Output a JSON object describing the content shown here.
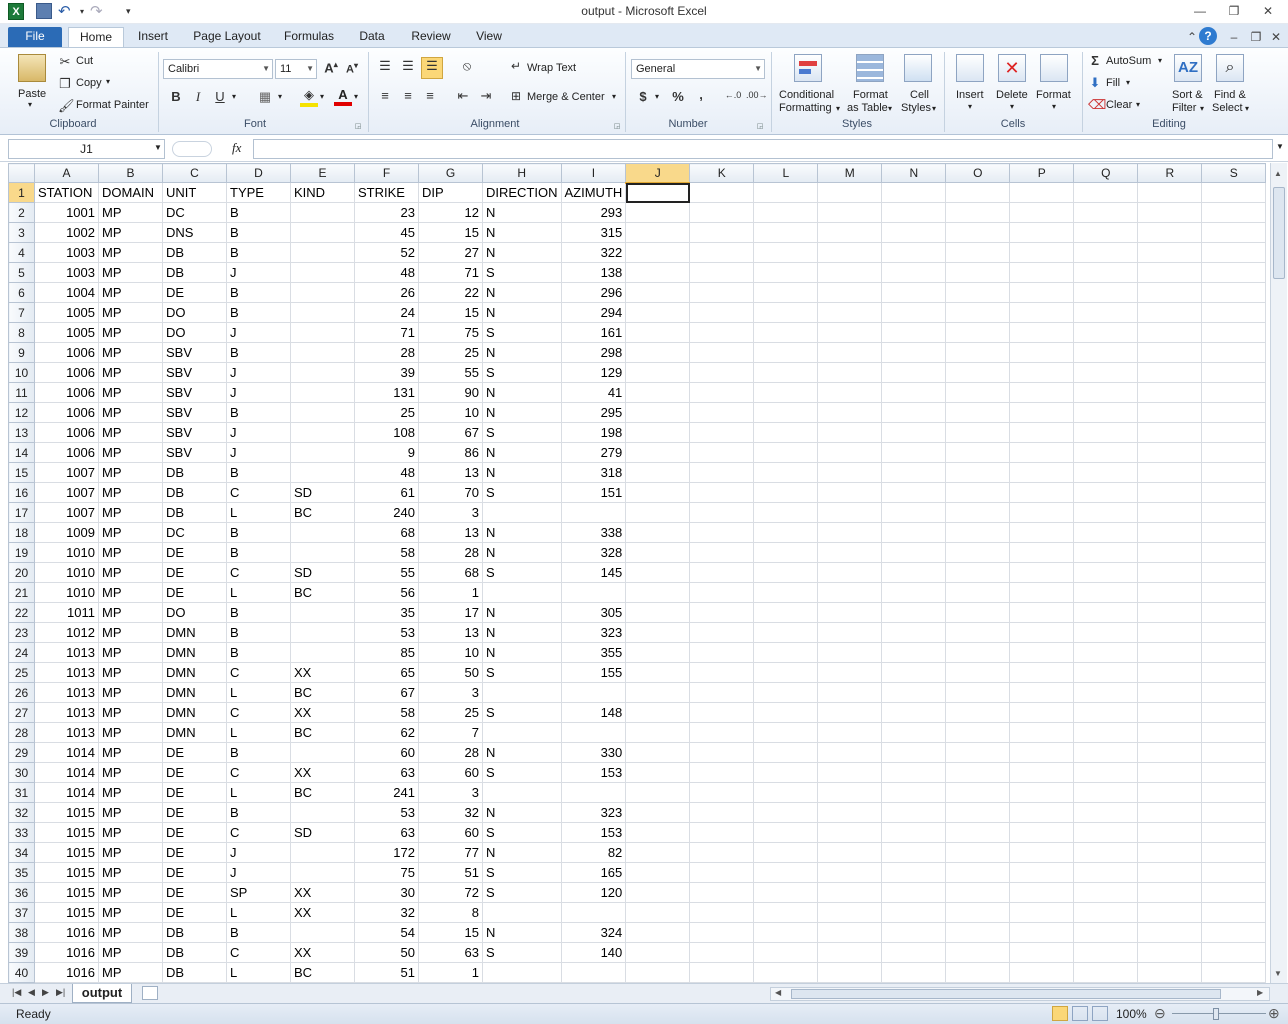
{
  "app": {
    "title": "output  -  Microsoft Excel",
    "logo": "X"
  },
  "qat": {
    "save_icon": "save-icon",
    "undo_icon": "undo-icon",
    "redo_icon": "redo-icon"
  },
  "tabs": {
    "file": "File",
    "home": "Home",
    "insert": "Insert",
    "page_layout": "Page Layout",
    "formulas": "Formulas",
    "data": "Data",
    "review": "Review",
    "view": "View"
  },
  "ribbon": {
    "clipboard": {
      "label": "Clipboard",
      "paste": "Paste",
      "cut": "Cut",
      "copy": "Copy",
      "format_painter": "Format Painter"
    },
    "font": {
      "label": "Font",
      "font_name": "Calibri",
      "font_size": "11",
      "bold": "B",
      "italic": "I",
      "underline": "U"
    },
    "alignment": {
      "label": "Alignment",
      "wrap_text": "Wrap Text",
      "merge_center": "Merge & Center"
    },
    "number": {
      "label": "Number",
      "format": "General",
      "currency": "$",
      "percent": "%",
      "comma": ","
    },
    "styles": {
      "label": "Styles",
      "conditional_1": "Conditional",
      "conditional_2": "Formatting",
      "format_table_1": "Format",
      "format_table_2": "as Table",
      "cell_styles_1": "Cell",
      "cell_styles_2": "Styles"
    },
    "cells": {
      "label": "Cells",
      "insert": "Insert",
      "delete": "Delete",
      "format": "Format"
    },
    "editing": {
      "label": "Editing",
      "autosum": "AutoSum",
      "fill": "Fill",
      "clear": "Clear",
      "sort_1": "Sort &",
      "sort_2": "Filter",
      "find_1": "Find &",
      "find_2": "Select"
    }
  },
  "formula_bar": {
    "name_box": "J1",
    "fx": "fx",
    "value": ""
  },
  "columns": [
    "A",
    "B",
    "C",
    "D",
    "E",
    "F",
    "G",
    "H",
    "I",
    "J",
    "K",
    "L",
    "M",
    "N",
    "O",
    "P",
    "Q",
    "R",
    "S"
  ],
  "rows": [
    [
      "STATION",
      "DOMAIN",
      "UNIT",
      "TYPE",
      "KIND",
      "STRIKE",
      "DIP",
      "DIRECTION",
      "AZIMUTH"
    ],
    [
      "1001",
      "MP",
      "DC",
      "B",
      "",
      "23",
      "12",
      "N",
      "293"
    ],
    [
      "1002",
      "MP",
      "DNS",
      "B",
      "",
      "45",
      "15",
      "N",
      "315"
    ],
    [
      "1003",
      "MP",
      "DB",
      "B",
      "",
      "52",
      "27",
      "N",
      "322"
    ],
    [
      "1003",
      "MP",
      "DB",
      "J",
      "",
      "48",
      "71",
      "S",
      "138"
    ],
    [
      "1004",
      "MP",
      "DE",
      "B",
      "",
      "26",
      "22",
      "N",
      "296"
    ],
    [
      "1005",
      "MP",
      "DO",
      "B",
      "",
      "24",
      "15",
      "N",
      "294"
    ],
    [
      "1005",
      "MP",
      "DO",
      "J",
      "",
      "71",
      "75",
      "S",
      "161"
    ],
    [
      "1006",
      "MP",
      "SBV",
      "B",
      "",
      "28",
      "25",
      "N",
      "298"
    ],
    [
      "1006",
      "MP",
      "SBV",
      "J",
      "",
      "39",
      "55",
      "S",
      "129"
    ],
    [
      "1006",
      "MP",
      "SBV",
      "J",
      "",
      "131",
      "90",
      "N",
      "41"
    ],
    [
      "1006",
      "MP",
      "SBV",
      "B",
      "",
      "25",
      "10",
      "N",
      "295"
    ],
    [
      "1006",
      "MP",
      "SBV",
      "J",
      "",
      "108",
      "67",
      "S",
      "198"
    ],
    [
      "1006",
      "MP",
      "SBV",
      "J",
      "",
      "9",
      "86",
      "N",
      "279"
    ],
    [
      "1007",
      "MP",
      "DB",
      "B",
      "",
      "48",
      "13",
      "N",
      "318"
    ],
    [
      "1007",
      "MP",
      "DB",
      "C",
      "SD",
      "61",
      "70",
      "S",
      "151"
    ],
    [
      "1007",
      "MP",
      "DB",
      "L",
      "BC",
      "240",
      "3",
      "",
      ""
    ],
    [
      "1009",
      "MP",
      "DC",
      "B",
      "",
      "68",
      "13",
      "N",
      "338"
    ],
    [
      "1010",
      "MP",
      "DE",
      "B",
      "",
      "58",
      "28",
      "N",
      "328"
    ],
    [
      "1010",
      "MP",
      "DE",
      "C",
      "SD",
      "55",
      "68",
      "S",
      "145"
    ],
    [
      "1010",
      "MP",
      "DE",
      "L",
      "BC",
      "56",
      "1",
      "",
      ""
    ],
    [
      "1011",
      "MP",
      "DO",
      "B",
      "",
      "35",
      "17",
      "N",
      "305"
    ],
    [
      "1012",
      "MP",
      "DMN",
      "B",
      "",
      "53",
      "13",
      "N",
      "323"
    ],
    [
      "1013",
      "MP",
      "DMN",
      "B",
      "",
      "85",
      "10",
      "N",
      "355"
    ],
    [
      "1013",
      "MP",
      "DMN",
      "C",
      "XX",
      "65",
      "50",
      "S",
      "155"
    ],
    [
      "1013",
      "MP",
      "DMN",
      "L",
      "BC",
      "67",
      "3",
      "",
      ""
    ],
    [
      "1013",
      "MP",
      "DMN",
      "C",
      "XX",
      "58",
      "25",
      "S",
      "148"
    ],
    [
      "1013",
      "MP",
      "DMN",
      "L",
      "BC",
      "62",
      "7",
      "",
      ""
    ],
    [
      "1014",
      "MP",
      "DE",
      "B",
      "",
      "60",
      "28",
      "N",
      "330"
    ],
    [
      "1014",
      "MP",
      "DE",
      "C",
      "XX",
      "63",
      "60",
      "S",
      "153"
    ],
    [
      "1014",
      "MP",
      "DE",
      "L",
      "BC",
      "241",
      "3",
      "",
      ""
    ],
    [
      "1015",
      "MP",
      "DE",
      "B",
      "",
      "53",
      "32",
      "N",
      "323"
    ],
    [
      "1015",
      "MP",
      "DE",
      "C",
      "SD",
      "63",
      "60",
      "S",
      "153"
    ],
    [
      "1015",
      "MP",
      "DE",
      "J",
      "",
      "172",
      "77",
      "N",
      "82"
    ],
    [
      "1015",
      "MP",
      "DE",
      "J",
      "",
      "75",
      "51",
      "S",
      "165"
    ],
    [
      "1015",
      "MP",
      "DE",
      "SP",
      "XX",
      "30",
      "72",
      "S",
      "120"
    ],
    [
      "1015",
      "MP",
      "DE",
      "L",
      "XX",
      "32",
      "8",
      "",
      ""
    ],
    [
      "1016",
      "MP",
      "DB",
      "B",
      "",
      "54",
      "15",
      "N",
      "324"
    ],
    [
      "1016",
      "MP",
      "DB",
      "C",
      "XX",
      "50",
      "63",
      "S",
      "140"
    ],
    [
      "1016",
      "MP",
      "DB",
      "L",
      "BC",
      "51",
      "1",
      "",
      ""
    ]
  ],
  "sheet": {
    "tab": "output"
  },
  "status": {
    "ready": "Ready",
    "zoom": "100%"
  }
}
